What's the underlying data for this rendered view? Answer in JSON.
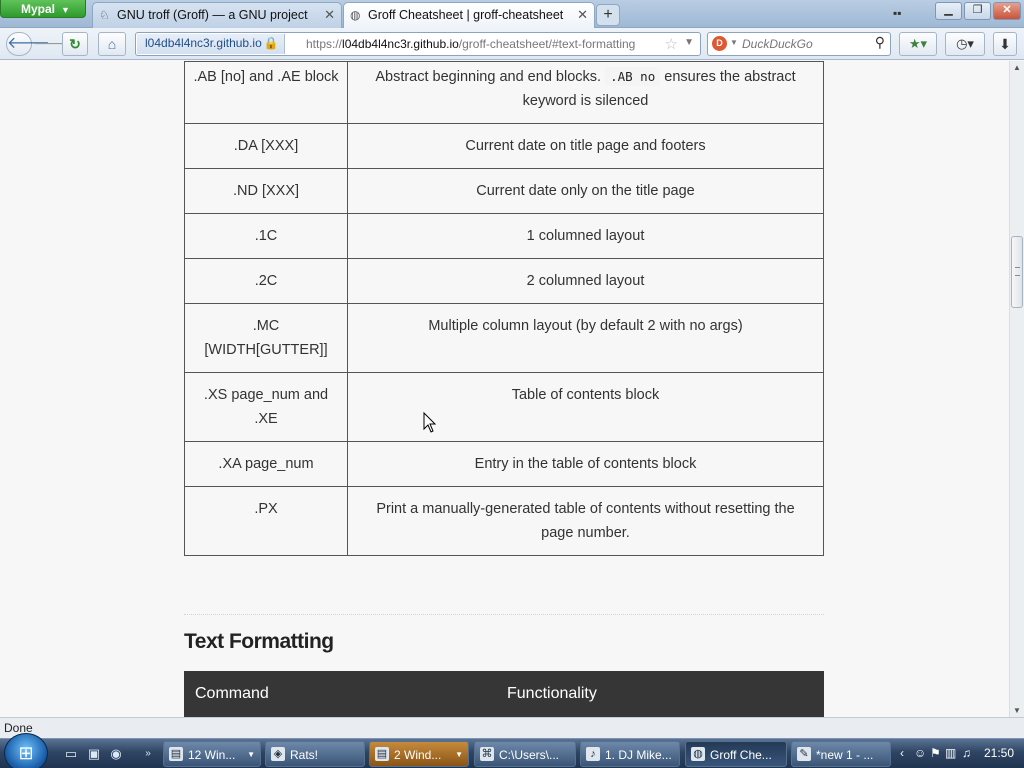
{
  "browser": {
    "app_menu_label": "Mypal",
    "tabs": [
      {
        "title": "GNU troff (Groff) — a GNU project",
        "active": false
      },
      {
        "title": "Groff Cheatsheet | groff-cheatsheet",
        "active": true
      }
    ],
    "identity_host": "l04db4l4nc3r.github.io",
    "url_prefix": "https://",
    "url_host": "l04db4l4nc3r.github.io",
    "url_path": "/groff-cheatsheet/#text-formatting",
    "search_placeholder": "DuckDuckGo",
    "status_text": "Done"
  },
  "content": {
    "table_rows": [
      {
        "command": ".AB [no] and .AE block",
        "desc_before": "Abstract beginning and end blocks.",
        "desc_code": ".AB no",
        "desc_after": "ensures the abstract keyword is silenced"
      },
      {
        "command": ".DA [XXX]",
        "description": "Current date on title page and footers"
      },
      {
        "command": ".ND [XXX]",
        "description": "Current date only on the title page"
      },
      {
        "command": ".1C",
        "description": "1 columned layout"
      },
      {
        "command": ".2C",
        "description": "2 columned layout"
      },
      {
        "command": ".MC [WIDTH[GUTTER]]",
        "description": "Multiple column layout (by default 2 with no args)"
      },
      {
        "command": ".XS page_num and .XE",
        "description": "Table of contents block"
      },
      {
        "command": ".XA page_num",
        "description": "Entry in the table of contents block"
      },
      {
        "command": ".PX",
        "description": "Print a manually-generated table of contents without resetting the page number."
      }
    ],
    "section_heading": "Text Formatting",
    "next_table_headers": {
      "command": "Command",
      "functionality": "Functionality"
    }
  },
  "taskbar": {
    "items": [
      {
        "label": "12 Win...",
        "icon": "folder-icon"
      },
      {
        "label": "Rats!",
        "icon": "app-icon"
      },
      {
        "label": "2 Wind...",
        "icon": "folder-icon"
      },
      {
        "label": "C:\\Users\\...",
        "icon": "console-icon"
      },
      {
        "label": "1. DJ Mike...",
        "icon": "media-icon"
      },
      {
        "label": "Groff Che...",
        "icon": "browser-icon"
      },
      {
        "label": "*new 1 - ...",
        "icon": "notepad-icon"
      }
    ],
    "clock": "21:50"
  },
  "colors": {
    "table_header_bg": "#363636",
    "app_menu_green": "#2f9a2c",
    "page_bg": "#f7f7f7"
  }
}
